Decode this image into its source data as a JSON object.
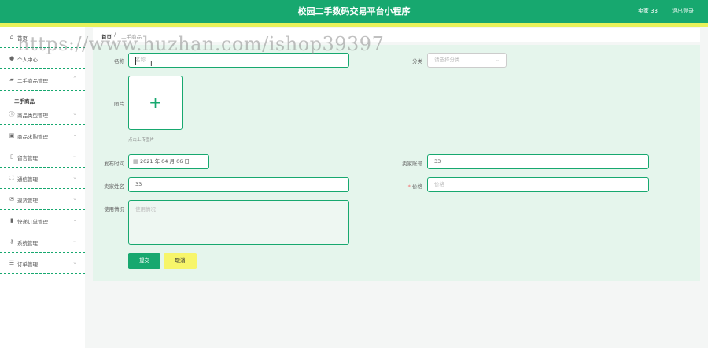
{
  "header": {
    "title": "校园二手数码交易平台小程序",
    "user": "卖家 33",
    "logout": "退出登录"
  },
  "sidebar": {
    "items": [
      {
        "label": "首页",
        "icon": "home-icon",
        "glyph": "⌂"
      },
      {
        "label": "个人中心",
        "icon": "user-icon",
        "glyph": "●"
      },
      {
        "label": "二手商品管理",
        "icon": "goods-icon",
        "glyph": "▰",
        "expanded": true
      },
      {
        "label": "商品类型管理",
        "icon": "info-icon",
        "glyph": "ⓘ"
      },
      {
        "label": "商品求购管理",
        "icon": "cart-icon",
        "glyph": "▣"
      },
      {
        "label": "留言管理",
        "icon": "phone-icon",
        "glyph": "▯"
      },
      {
        "label": "通信管理",
        "icon": "scan-icon",
        "glyph": "⛶"
      },
      {
        "label": "退货管理",
        "icon": "mail-icon",
        "glyph": "✉"
      },
      {
        "label": "快递订单管理",
        "icon": "chart-icon",
        "glyph": "▮"
      },
      {
        "label": "系统管理",
        "icon": "lock-icon",
        "glyph": "⚷"
      },
      {
        "label": "订单管理",
        "icon": "list-icon",
        "glyph": "☰"
      }
    ],
    "subitem": "二手商品"
  },
  "watermark": "https://www.huzhan.com/ishop39397",
  "breadcrumb": {
    "home": "首页",
    "separator": "/",
    "current": "二手商品"
  },
  "form": {
    "name_label": "名称",
    "name_placeholder": "名称",
    "category_label": "分类",
    "category_placeholder": "请选择分类",
    "image_label": "图片",
    "upload_hint": "点击上传图片",
    "publish_time_label": "发布时间",
    "publish_time_value": "2021 年 04 月 06 日",
    "seller_account_label": "卖家账号",
    "seller_account_value": "33",
    "seller_name_label": "卖家姓名",
    "seller_name_value": "33",
    "price_required": "*",
    "price_label": "价格",
    "price_placeholder": "价格",
    "usage_label": "使用情况",
    "usage_placeholder": "使用情况",
    "submit": "提交",
    "cancel": "取消"
  },
  "colors": {
    "primary": "#17a86f",
    "accent_strip": "#e8f25a",
    "cancel_button": "#f7f56a",
    "form_bg": "#e5f5ec"
  }
}
